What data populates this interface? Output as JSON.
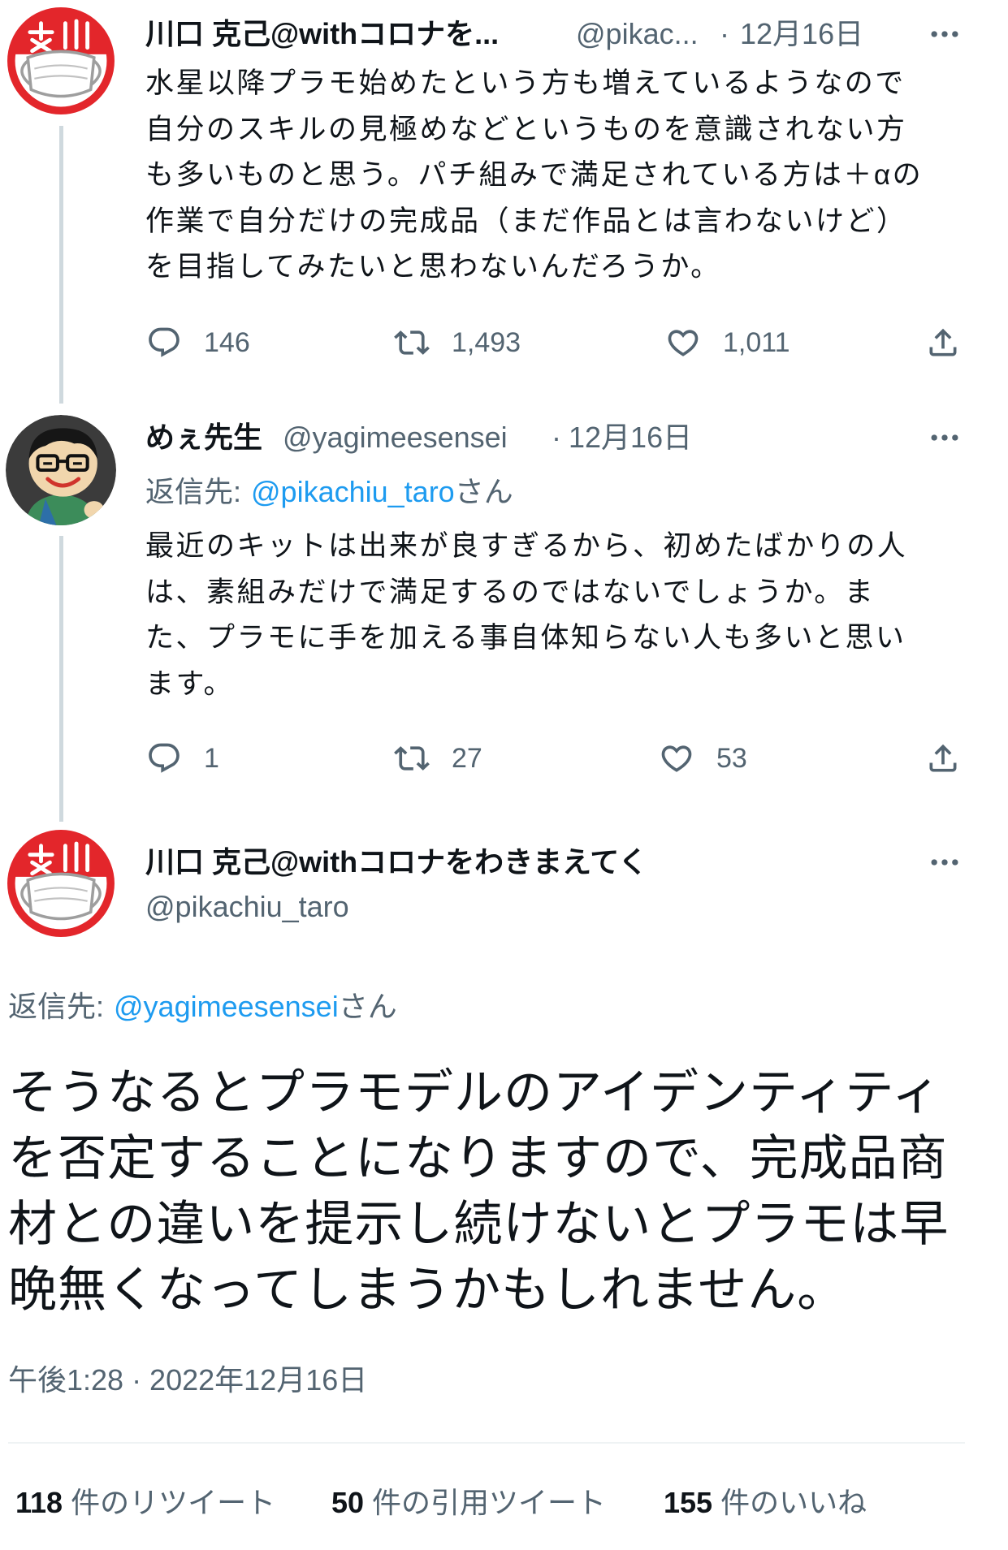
{
  "colors": {
    "text": "#0f1419",
    "secondary": "#536471",
    "link": "#1d9bf0",
    "thread_line": "#cfd9de",
    "divider": "#eff3f4",
    "avatar_red": "#e3262b"
  },
  "icons": {
    "reply": "reply-icon",
    "retweet": "retweet-icon",
    "like": "heart-icon",
    "share": "share-icon",
    "more": "more-icon"
  },
  "thread": [
    {
      "author_name": "川口 克己@withコロナを...",
      "handle": "@pikac...",
      "separator": "·",
      "date": "12月16日",
      "body": [
        "水星以降プラモ始めたという方も増えているようなので",
        "自分のスキルの見極めなどというものを意識されない方",
        "も多いものと思う。パチ組みで満足されている方は＋αの",
        "作業で自分だけの完成品（まだ作品とは言わないけど）",
        "を目指してみたいと思わないんだろうか。"
      ],
      "replies": "146",
      "retweets": "1,493",
      "likes": "1,011"
    },
    {
      "author_name": "めぇ先生",
      "handle": "@yagimeesensei",
      "separator": "·",
      "date": "12月16日",
      "reply_to": {
        "prefix": "返信先:",
        "handle": "@pikachiu_taro",
        "suffix": "さん"
      },
      "body": [
        "最近のキットは出来が良すぎるから、初めたばかりの人",
        "は、素組みだけで満足するのではないでしょうか。ま",
        "た、プラモに手を加える事自体知らない人も多いと思い",
        "ます。"
      ],
      "replies": "1",
      "retweets": "27",
      "likes": "53"
    }
  ],
  "focused_tweet": {
    "author_name": "川口 克己@withコロナをわきまえてく",
    "handle": "@pikachiu_taro",
    "reply_to": {
      "prefix": "返信先:",
      "handle": "@yagimeesensei",
      "suffix": "さん"
    },
    "body": [
      "そうなるとプラモデルのアイデンティティ",
      "を否定することになりますので、完成品商",
      "材との違いを提示し続けないとプラモは早",
      "晩無くなってしまうかもしれません。"
    ],
    "timestamp": "午後1:28 · 2022年12月16日",
    "stats": [
      {
        "count": "118",
        "label": "件のリツイート"
      },
      {
        "count": "50",
        "label": "件の引用ツイート"
      },
      {
        "count": "155",
        "label": "件のいいね"
      }
    ]
  }
}
